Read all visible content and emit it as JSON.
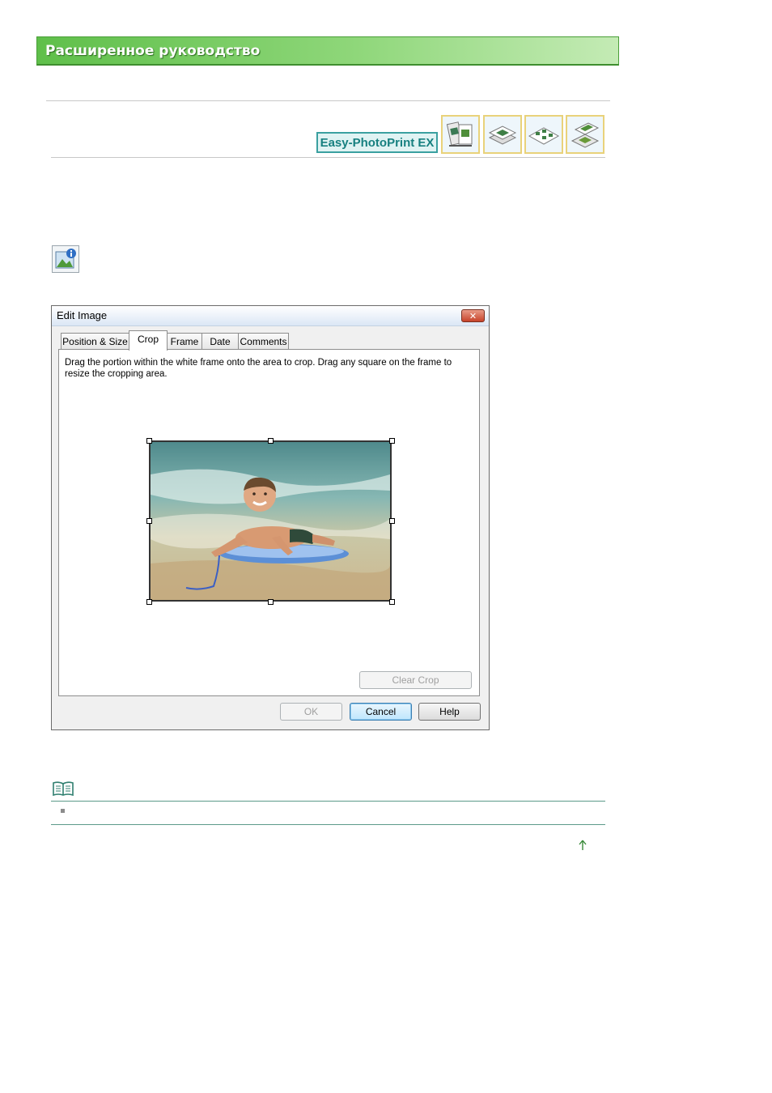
{
  "header": {
    "title": "Расширенное руководство"
  },
  "product": {
    "logo_text": "Easy-PhotoPrint EX"
  },
  "mode_icons": [
    "album-mode-icon",
    "calendar-mode-icon",
    "layout-print-mode-icon",
    "photo-print-mode-icon"
  ],
  "dialog": {
    "title": "Edit Image",
    "close_symbol": "✕",
    "tabs": [
      {
        "label": "Position & Size",
        "active": false
      },
      {
        "label": "Crop",
        "active": true
      },
      {
        "label": "Frame",
        "active": false
      },
      {
        "label": "Date",
        "active": false
      },
      {
        "label": "Comments",
        "active": false
      }
    ],
    "instructions": "Drag the portion within the white frame onto the area to crop. Drag any square on the frame to resize the cropping area.",
    "clear_crop_label": "Clear Crop",
    "ok_label": "OK",
    "cancel_label": "Cancel",
    "help_label": "Help"
  },
  "colors": {
    "banner_green": "#5fbf4a",
    "logo_teal": "#178080",
    "dialog_bg": "#f0f0f0"
  }
}
